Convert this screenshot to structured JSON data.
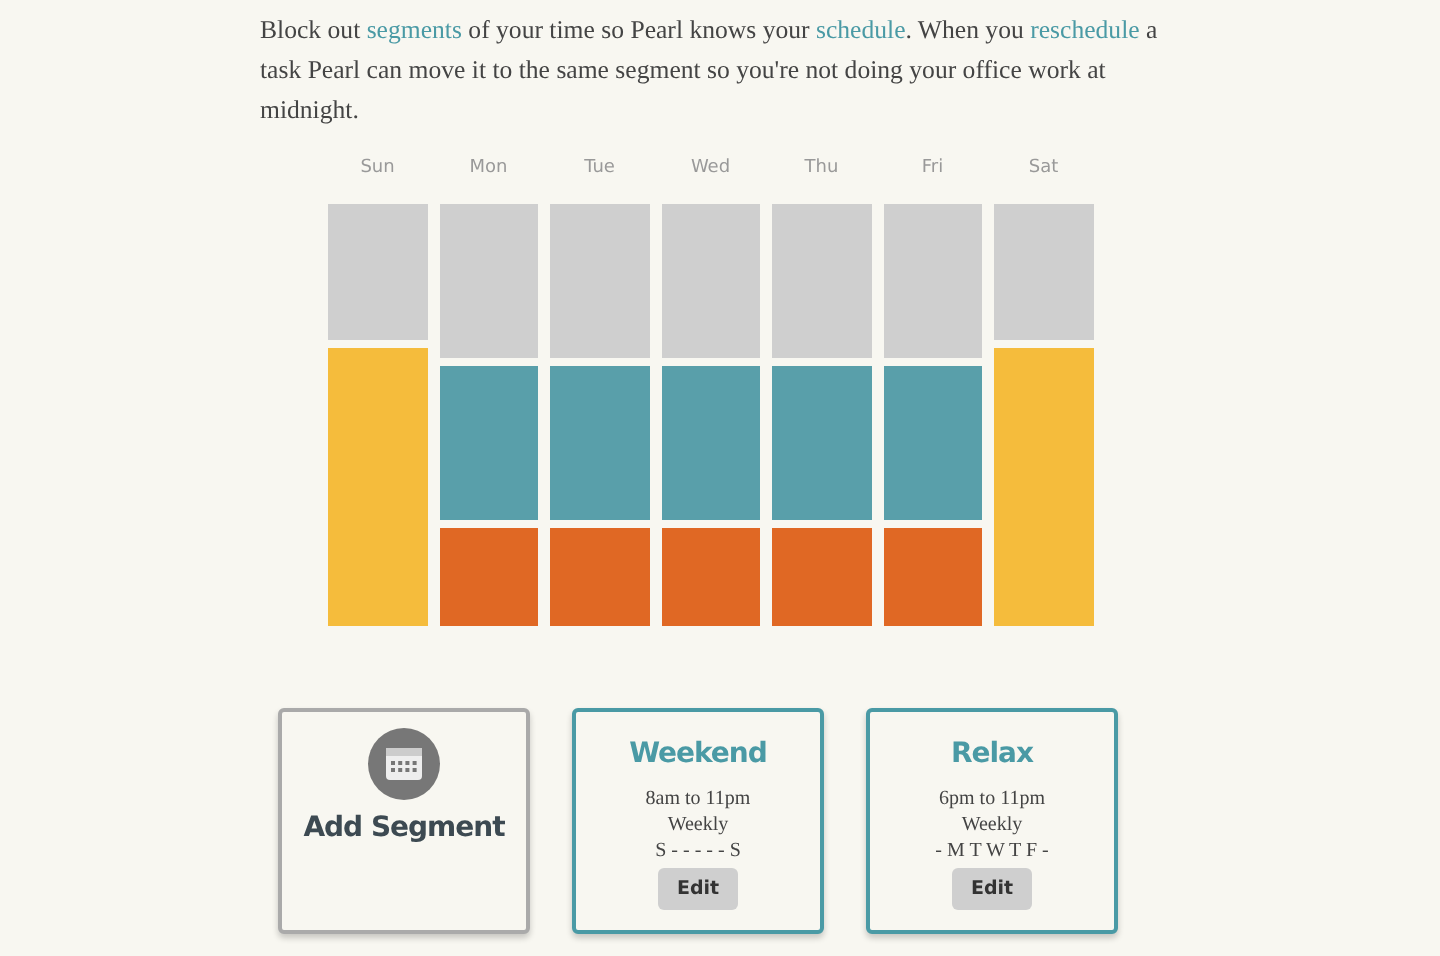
{
  "intro": "Block out **segments** of your time so Pearl knows your **schedule**. When you **reschedule** a task Pearl can move it to the same segment so you're not doing your office work at midnight.",
  "days": [
    {
      "label": "Sun",
      "blocks": [
        {
          "kind": "dawn",
          "color": "#cfcfcf"
        },
        {
          "kind": "weekend",
          "color": "#f5bc3c"
        }
      ]
    },
    {
      "label": "Mon",
      "blocks": [
        {
          "kind": "morning",
          "color": "#cfcfcf"
        },
        {
          "kind": "work",
          "color": "#599faa"
        },
        {
          "kind": "relax",
          "color": "#e06824"
        }
      ]
    },
    {
      "label": "Tue",
      "blocks": [
        {
          "kind": "morning",
          "color": "#cfcfcf"
        },
        {
          "kind": "work",
          "color": "#599faa"
        },
        {
          "kind": "relax",
          "color": "#e06824"
        }
      ]
    },
    {
      "label": "Wed",
      "blocks": [
        {
          "kind": "morning",
          "color": "#cfcfcf"
        },
        {
          "kind": "work",
          "color": "#599faa"
        },
        {
          "kind": "relax",
          "color": "#e06824"
        }
      ]
    },
    {
      "label": "Thu",
      "blocks": [
        {
          "kind": "morning",
          "color": "#cfcfcf"
        },
        {
          "kind": "work",
          "color": "#599faa"
        },
        {
          "kind": "relax",
          "color": "#e06824"
        }
      ]
    },
    {
      "label": "Fri",
      "blocks": [
        {
          "kind": "morning",
          "color": "#cfcfcf"
        },
        {
          "kind": "work",
          "color": "#599faa"
        },
        {
          "kind": "relax",
          "color": "#e06824"
        }
      ]
    },
    {
      "label": "Sat",
      "blocks": [
        {
          "kind": "dawn",
          "color": "#cfcfcf"
        },
        {
          "kind": "weekend",
          "color": "#f5bc3c"
        }
      ]
    }
  ],
  "add_card": {
    "label": "Add Segment"
  },
  "segments": [
    {
      "name": "Weekend",
      "time": "8am to 11pm",
      "repeat": "Weekly",
      "days": "S - - - - - S",
      "button": "Edit"
    },
    {
      "name": "Relax",
      "time": "6pm to 11pm",
      "repeat": "Weekly",
      "days": "- M T W T F -",
      "button": "Edit"
    }
  ]
}
